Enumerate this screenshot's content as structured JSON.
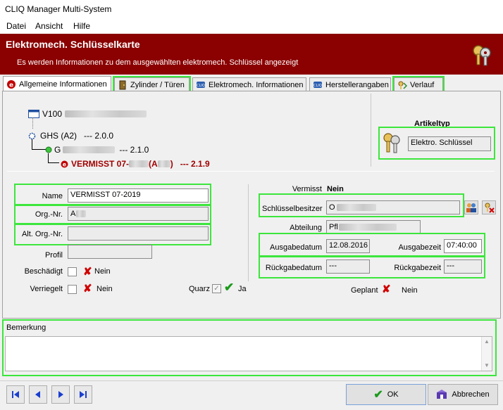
{
  "window": {
    "title": "CLIQ Manager Multi-System"
  },
  "menu": [
    "Datei",
    "Ansicht",
    "Hilfe"
  ],
  "header": {
    "title": "Elektromech. Schlüsselkarte",
    "subtitle": "Es werden Informationen zu dem ausgewählten elektromech. Schlüssel angezeigt"
  },
  "tabs": [
    {
      "label": "Allgemeine Informationen"
    },
    {
      "label": "Zylinder / Türen"
    },
    {
      "label": "Elektromech. Informationen"
    },
    {
      "label": "Herstellerangaben"
    },
    {
      "label": "Verlauf"
    }
  ],
  "tree": {
    "root": "V100",
    "ghs": "GHS (A2)",
    "ghs_version": "--- 2.0.0",
    "group_prefix": "G",
    "group_version": "--- 2.1.0",
    "key_label": "VERMISST 07-",
    "key_mid": " (A",
    "key_end": ")",
    "key_version": "--- 2.1.9"
  },
  "artikeltyp": {
    "label": "Artikeltyp",
    "value": "Elektro. Schlüssel"
  },
  "form": {
    "name_label": "Name",
    "name_value": "VERMISST 07-2019",
    "org_label": "Org.-Nr.",
    "org_value": "A",
    "altorg_label": "Alt. Org.-Nr.",
    "altorg_value": "",
    "profil_label": "Profil",
    "profil_value": "",
    "beschaedigt_label": "Beschädigt",
    "beschaedigt_value": "Nein",
    "verriegelt_label": "Verriegelt",
    "verriegelt_value": "Nein",
    "quarz_label": "Quarz",
    "quarz_value": "Ja"
  },
  "right": {
    "vermisst_label": "Vermisst",
    "vermisst_value": "Nein",
    "besitzer_label": "Schlüsselbesitzer",
    "besitzer_value": "O",
    "abteilung_label": "Abteilung",
    "abteilung_value": "Pfl",
    "ausgabedatum_label": "Ausgabedatum",
    "ausgabedatum_value": "12.08.2016",
    "ausgabezeit_label": "Ausgabezeit",
    "ausgabezeit_value": "07:40:00",
    "rueckgabedatum_label": "Rückgabedatum",
    "rueckgabedatum_value": "---",
    "rueckgabezeit_label": "Rückgabezeit",
    "rueckgabezeit_value": "---",
    "geplant_label": "Geplant",
    "geplant_value": "Nein"
  },
  "bemerkung": {
    "label": "Bemerkung",
    "value": ""
  },
  "footer": {
    "ok_label": "OK",
    "cancel_label": "Abbrechen"
  },
  "colors": {
    "header_bg": "#8b0000",
    "highlight": "#3ce63c",
    "missing_text": "#a00000"
  }
}
